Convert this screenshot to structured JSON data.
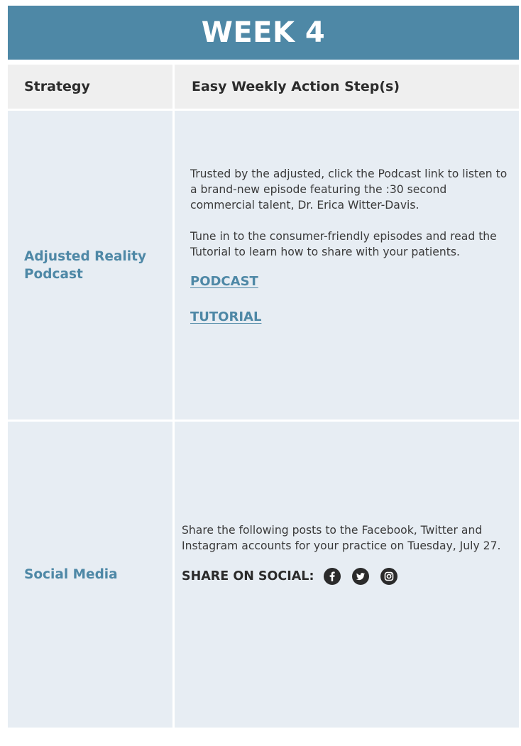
{
  "header": {
    "title": "WEEK 4"
  },
  "columns": {
    "strategy": "Strategy",
    "action": "Easy Weekly Action Step(s)"
  },
  "rows": [
    {
      "strategy": "Adjusted Reality Podcast",
      "paragraphs": [
        "Trusted by the adjusted, click the Podcast link to listen to a brand-new episode featuring the :30 second commercial talent, Dr. Erica Witter-Davis.",
        "Tune in to the consumer-friendly episodes and read the Tutorial to learn how to share with your patients."
      ],
      "links": [
        "PODCAST",
        "TUTORIAL"
      ]
    },
    {
      "strategy": "Social Media",
      "paragraphs": [
        "Share the following posts to the Facebook, Twitter and Instagram accounts for your practice on Tuesday, July 27."
      ],
      "share_label": "SHARE ON SOCIAL:",
      "icons": [
        "facebook-icon",
        "twitter-icon",
        "instagram-icon"
      ]
    }
  ],
  "colors": {
    "header_bg": "#4e88a6",
    "cell_bg": "#e7edf3",
    "column_header_bg": "#efefef",
    "accent_text": "#4e88a6"
  }
}
